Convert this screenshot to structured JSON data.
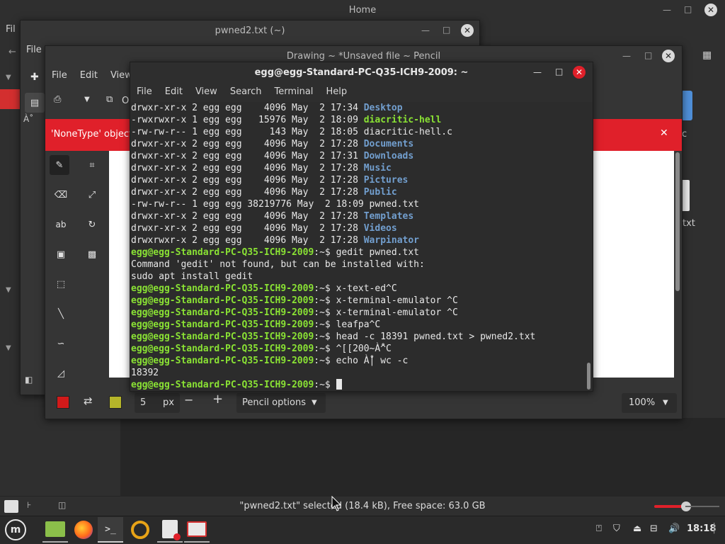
{
  "home": {
    "title": "Home",
    "menu_file": "Fil",
    "file_label": "txt",
    "c_label": "c",
    "status": "\"pwned2.txt\" selected (18.4 kB), Free space: 63.0 GB"
  },
  "editor": {
    "title": "pwned2.txt (~)",
    "menu_file": "File",
    "file_icon_label": "À˚"
  },
  "pencil": {
    "title": "Drawing ~ *Unsaved file ~ Pencil",
    "menu": [
      "File",
      "Edit",
      "View"
    ],
    "error": "'NoneType' object",
    "toolbar_o": "O",
    "size_value": "5",
    "size_unit": "px",
    "options_label": "Pencil options",
    "zoom": "100%",
    "colors": {
      "primary": "#d11a1a",
      "secondary": "#b5b52a",
      "error_bar": "#e0202a"
    }
  },
  "terminal": {
    "title": "egg@egg-Standard-PC-Q35-ICH9-2009: ~",
    "menu": [
      "File",
      "Edit",
      "View",
      "Search",
      "Terminal",
      "Help"
    ],
    "lines": [
      {
        "pre": "drwxr-xr-x 2 egg egg    4096 May  2 17:34 ",
        "name": "Desktop",
        "cls": "b"
      },
      {
        "pre": "-rwxrwxr-x 1 egg egg   15976 May  2 18:09 ",
        "name": "diacritic-hell",
        "cls": "lg"
      },
      {
        "pre": "-rw-rw-r-- 1 egg egg     143 May  2 18:05 ",
        "name": "diacritic-hell.c",
        "cls": "w"
      },
      {
        "pre": "drwxr-xr-x 2 egg egg    4096 May  2 17:28 ",
        "name": "Documents",
        "cls": "b"
      },
      {
        "pre": "drwxr-xr-x 2 egg egg    4096 May  2 17:31 ",
        "name": "Downloads",
        "cls": "b"
      },
      {
        "pre": "drwxr-xr-x 2 egg egg    4096 May  2 17:28 ",
        "name": "Music",
        "cls": "b"
      },
      {
        "pre": "drwxr-xr-x 2 egg egg    4096 May  2 17:28 ",
        "name": "Pictures",
        "cls": "b"
      },
      {
        "pre": "drwxr-xr-x 2 egg egg    4096 May  2 17:28 ",
        "name": "Public",
        "cls": "b"
      },
      {
        "pre": "-rw-rw-r-- 1 egg egg 38219776 May  2 18:09 ",
        "name": "pwned.txt",
        "cls": "w"
      },
      {
        "pre": "drwxr-xr-x 2 egg egg    4096 May  2 17:28 ",
        "name": "Templates",
        "cls": "b"
      },
      {
        "pre": "drwxr-xr-x 2 egg egg    4096 May  2 17:28 ",
        "name": "Videos",
        "cls": "b"
      },
      {
        "pre": "drwxrwxr-x 2 egg egg    4096 May  2 17:28 ",
        "name": "Warpinator",
        "cls": "b"
      }
    ],
    "prompt_user": "egg@egg-Standard-PC-Q35-ICH9-2009",
    "prompt_tail": ":~$ ",
    "session": [
      {
        "type": "cmd",
        "text": "gedit pwned.txt"
      },
      {
        "type": "out",
        "text": "Command 'gedit' not found, but can be installed with:"
      },
      {
        "type": "out",
        "text": "sudo apt install gedit"
      },
      {
        "type": "cmd",
        "text": "x-text-ed^C"
      },
      {
        "type": "cmd",
        "text": "x-terminal-emulator ^C"
      },
      {
        "type": "cmd",
        "text": "x-terminal-emulator ^C"
      },
      {
        "type": "cmd",
        "text": "leafpa^C"
      },
      {
        "type": "cmd",
        "text": "head -c 18391 pwned.txt > pwned2.txt"
      },
      {
        "type": "cmd",
        "text": "^[[200~À̊^C"
      },
      {
        "type": "cmd",
        "text": "echo À̊| wc -c"
      },
      {
        "type": "out",
        "text": "18392"
      },
      {
        "type": "cmd",
        "text": ""
      }
    ]
  },
  "taskbar": {
    "time": "18:18",
    "apps": [
      "menu-icon",
      "files-icon",
      "firefox-icon",
      "terminal-icon",
      "warpinator-icon",
      "text-editor-icon",
      "pencil-icon"
    ]
  }
}
